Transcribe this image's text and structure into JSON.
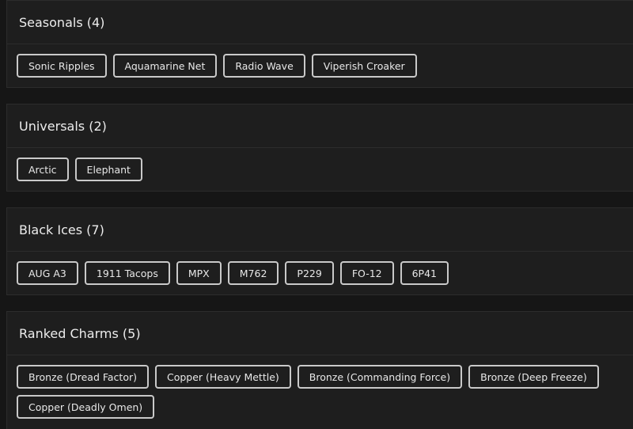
{
  "sections": [
    {
      "title": "Seasonals (4)",
      "items": [
        "Sonic Ripples",
        "Aquamarine Net",
        "Radio Wave",
        "Viperish Croaker"
      ]
    },
    {
      "title": "Universals (2)",
      "items": [
        "Arctic",
        "Elephant"
      ]
    },
    {
      "title": "Black Ices (7)",
      "items": [
        "AUG A3",
        "1911 Tacops",
        "MPX",
        "M762",
        "P229",
        "FO-12",
        "6P41"
      ]
    },
    {
      "title": "Ranked Charms (5)",
      "items": [
        "Bronze (Dread Factor)",
        "Copper (Heavy Mettle)",
        "Bronze (Commanding Force)",
        "Bronze (Deep Freeze)",
        "Copper (Deadly Omen)"
      ]
    }
  ]
}
